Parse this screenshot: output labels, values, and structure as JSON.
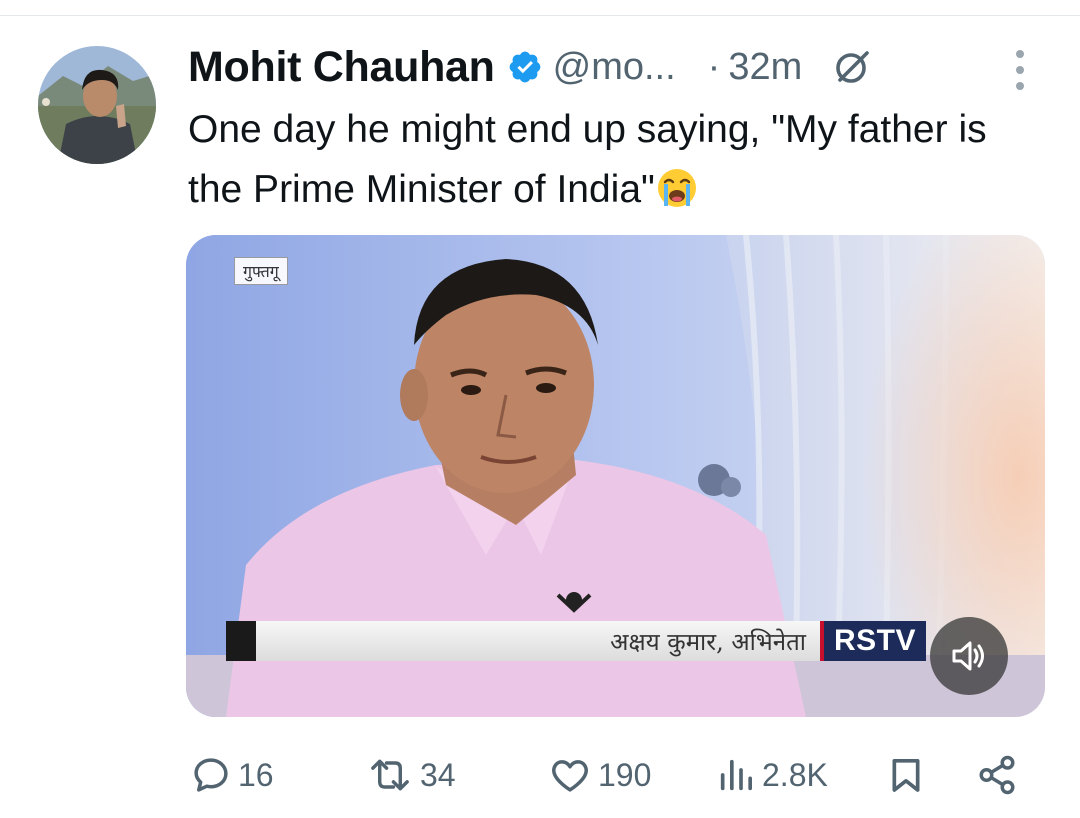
{
  "tweet": {
    "author_name": "Mohit Chauhan",
    "handle": "@mo...",
    "dot": "·",
    "time": "32m",
    "text": "One day he might end up saying, \"My father is the Prime Minister of India\"",
    "emoji": "loudly-crying-face"
  },
  "media": {
    "channel_tag": "गुफ्तगू",
    "caption": "अक्षय कुमार, अभिनेता",
    "channel_logo": "RSTV",
    "mute_icon": "speaker-icon"
  },
  "actions": {
    "replies": "16",
    "reposts": "34",
    "likes": "190",
    "views": "2.8K"
  },
  "colors": {
    "verified": "#1d9bf0",
    "secondary_text": "#536471",
    "primary_text": "#0f1419"
  }
}
